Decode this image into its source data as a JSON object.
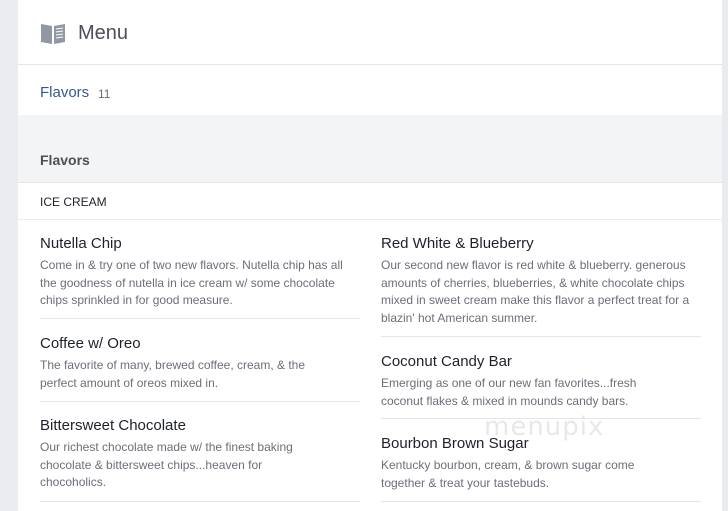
{
  "header": {
    "title": "Menu",
    "icon": "book-icon"
  },
  "tabs": [
    {
      "label": "Flavors",
      "count": "11"
    }
  ],
  "section": {
    "title": "Flavors"
  },
  "category": {
    "label": "ICE CREAM"
  },
  "items_left": [
    {
      "name": "Nutella Chip",
      "description": "Come in & try one of two new flavors. Nutella chip has all the goodness of nutella in ice cream w/ some chocolate chips sprinkled in for good measure."
    },
    {
      "name": "Coffee w/ Oreo",
      "description": "The favorite of many, brewed coffee, cream, & the perfect amount of oreos mixed in."
    },
    {
      "name": "Bittersweet Chocolate",
      "description": "Our richest chocolate made w/ the finest baking chocolate & bittersweet chips...heaven for chocoholics."
    }
  ],
  "items_right": [
    {
      "name": "Red White & Blueberry",
      "description": "Our second new flavor is red white & blueberry. generous amounts of cherries, blueberries, & white chocolate chips mixed in sweet cream make this flavor a perfect treat for a blazin' hot American summer."
    },
    {
      "name": "Coconut Candy Bar",
      "description": "Emerging as one of our new fan favorites...fresh coconut flakes & mixed in mounds candy bars."
    },
    {
      "name": "Bourbon Brown Sugar",
      "description": "Kentucky bourbon, cream, & brown sugar come together & treat your tastebuds."
    }
  ],
  "watermark": "menupix",
  "colors": {
    "link": "#365899",
    "background": "#e9ebee",
    "muted_text": "#6a6f78"
  }
}
